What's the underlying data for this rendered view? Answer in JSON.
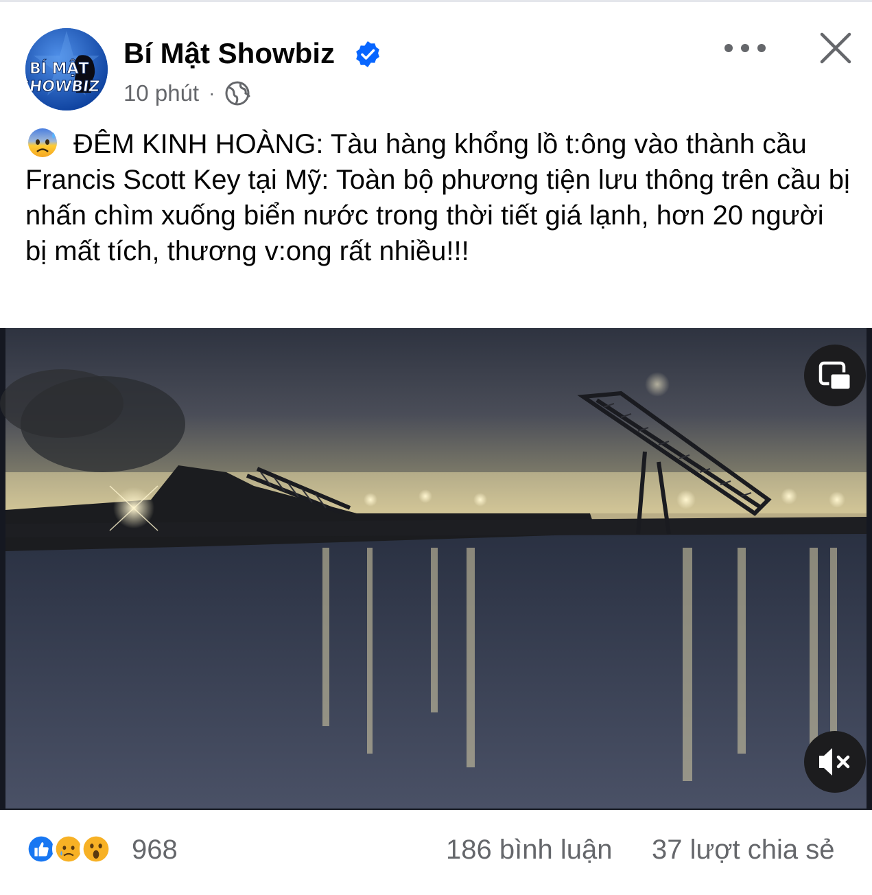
{
  "post": {
    "page_name": "Bí Mật Showbiz",
    "avatar_text_top": "BÍ MẬT",
    "avatar_text_bottom": "SHOWBIZ",
    "time": "10 phút",
    "separator": "·",
    "privacy_icon": "globe-icon",
    "verified_icon": "verified-badge-icon",
    "menu_icon": "more-horizontal-icon",
    "close_icon": "close-icon",
    "caption_emoji": "anxious-face-with-sweat-emoji",
    "caption": "ĐÊM KINH HOÀNG: Tàu hàng khổng lồ t:ông vào thành cầu Francis Scott Key tại Mỹ: Toàn bộ phương tiện lưu thông trên cầu bị nhấn chìm xuống biển nước trong thời tiết giá lạnh, hơn 20 người bị mất tích, thương v:ong rất nhiều!!!"
  },
  "video": {
    "pip_icon": "picture-in-picture-icon",
    "mute_icon": "muted-speaker-icon"
  },
  "footer": {
    "reaction_icons": [
      "like-icon",
      "sad-icon",
      "wow-icon"
    ],
    "reaction_count": "968",
    "comments": "186 bình luận",
    "shares": "37 lượt chia sẻ"
  },
  "colors": {
    "brand_blue": "#0866ff",
    "secondary_text": "#65676b",
    "primary_text": "#050505",
    "video_button_bg": "#1c1c1e"
  }
}
